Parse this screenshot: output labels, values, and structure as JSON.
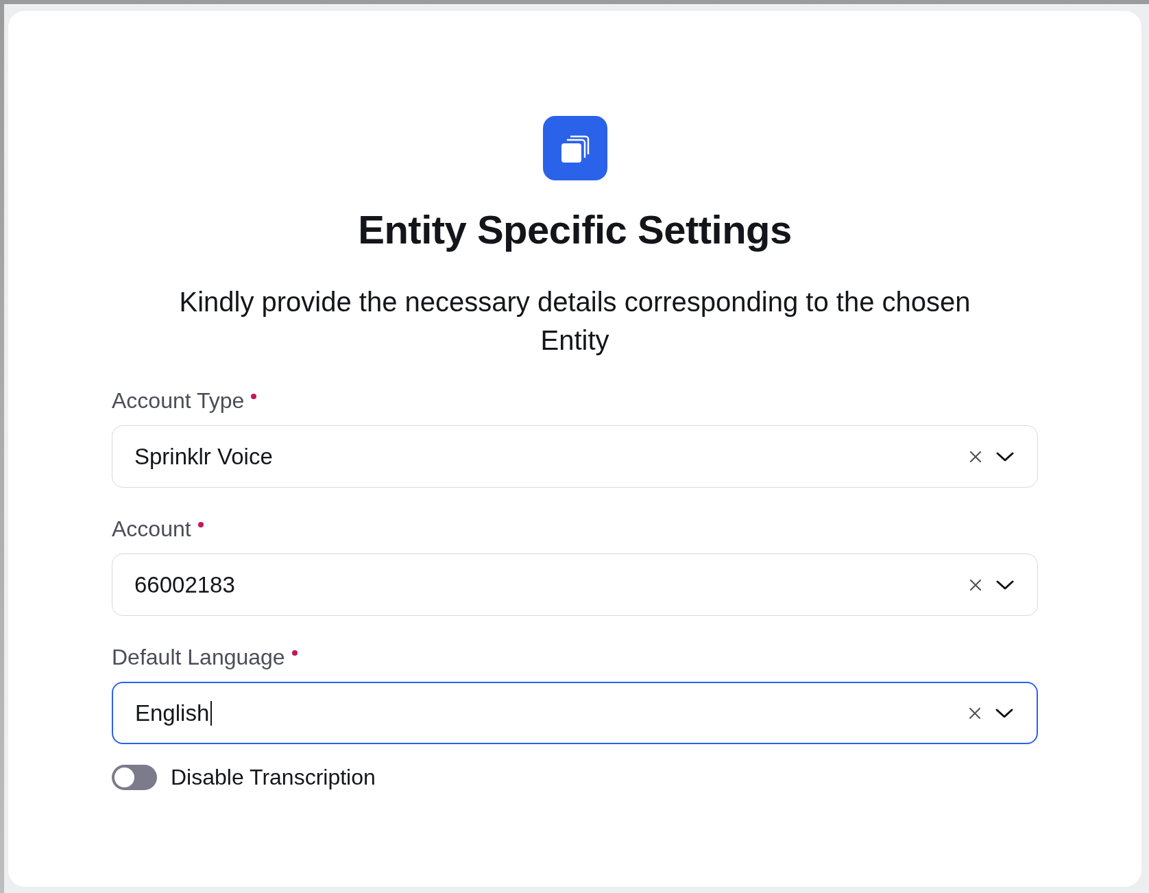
{
  "title": "Entity Specific Settings",
  "subtitle": "Kindly provide the necessary details corresponding to the chosen Entity",
  "fields": [
    {
      "label": "Account Type",
      "required": true,
      "value": "Sprinklr Voice",
      "focused": false
    },
    {
      "label": "Account",
      "required": true,
      "value": "66002183",
      "focused": false
    },
    {
      "label": "Default Language",
      "required": true,
      "value": "English",
      "focused": true
    }
  ],
  "toggle": {
    "label": "Disable Transcription",
    "on": false
  }
}
